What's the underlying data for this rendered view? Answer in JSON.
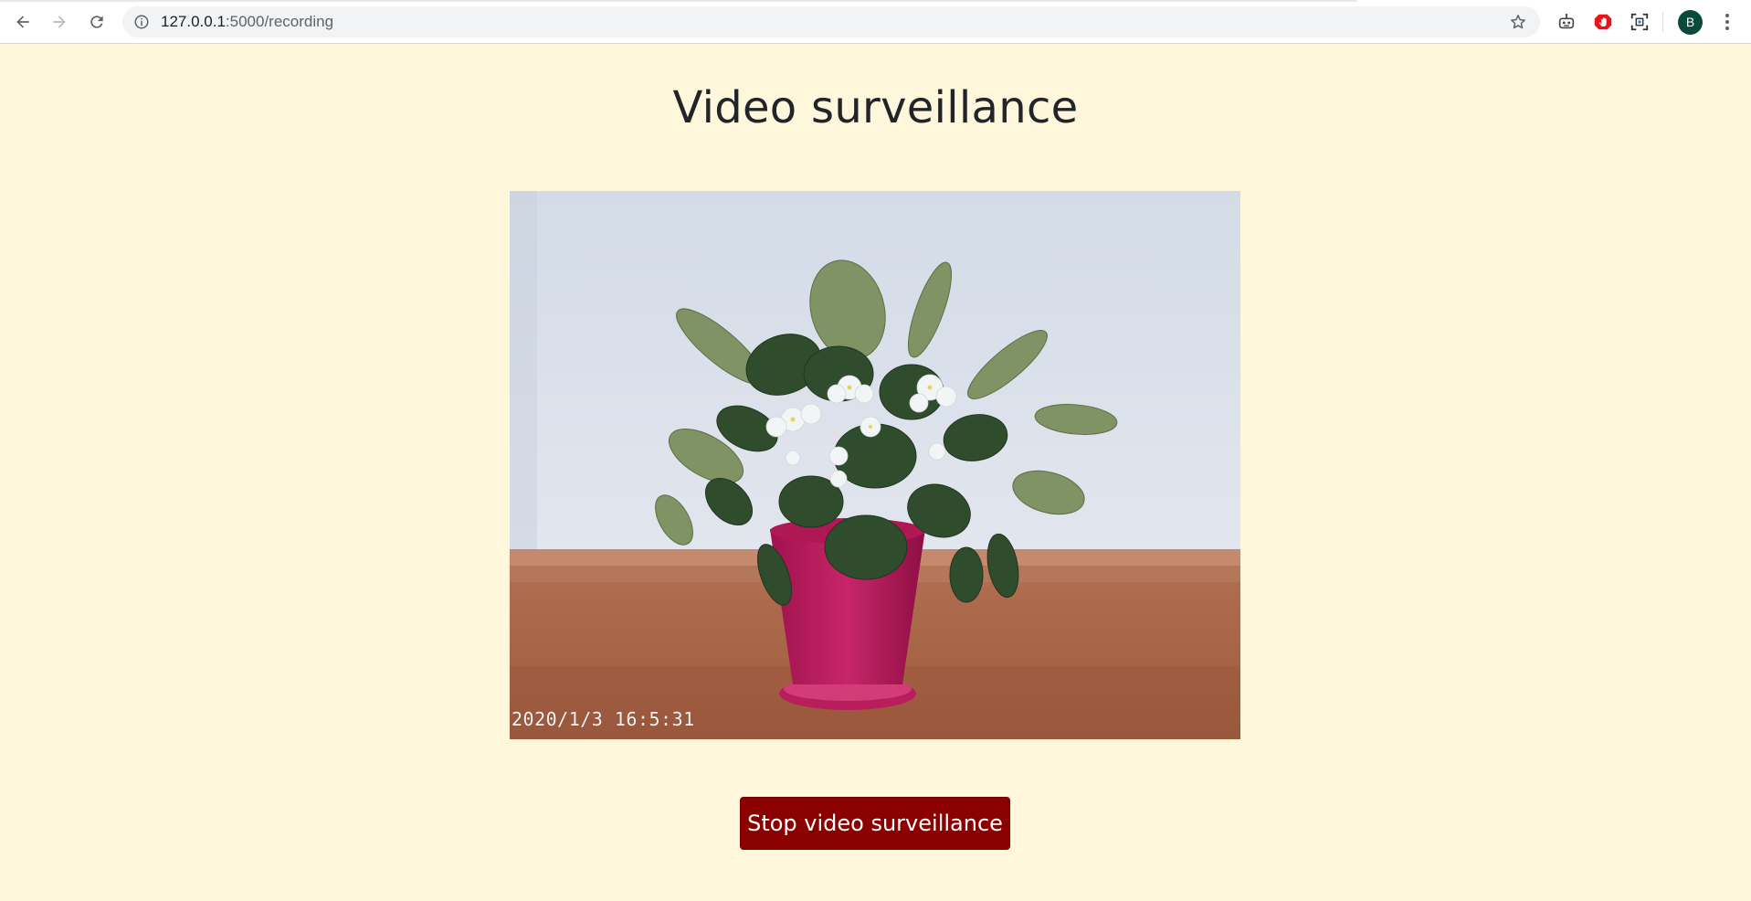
{
  "browser": {
    "url_host": "127.0.0.1",
    "url_path": ":5000/recording",
    "profile_initial": "B",
    "icons": [
      "back-arrow-icon",
      "forward-arrow-icon",
      "reload-icon",
      "info-icon",
      "star-icon",
      "robot-extension-icon",
      "stop-hand-extension-icon",
      "screen-capture-extension-icon",
      "kebab-menu-icon"
    ]
  },
  "page": {
    "title": "Video surveillance",
    "video": {
      "timestamp": "2020/1/3  16:5:31"
    },
    "stop_button_label": "Stop video surveillance"
  },
  "colors": {
    "page_background": "#fff7dc",
    "button_background": "#8b0000",
    "title_text": "#212529"
  }
}
